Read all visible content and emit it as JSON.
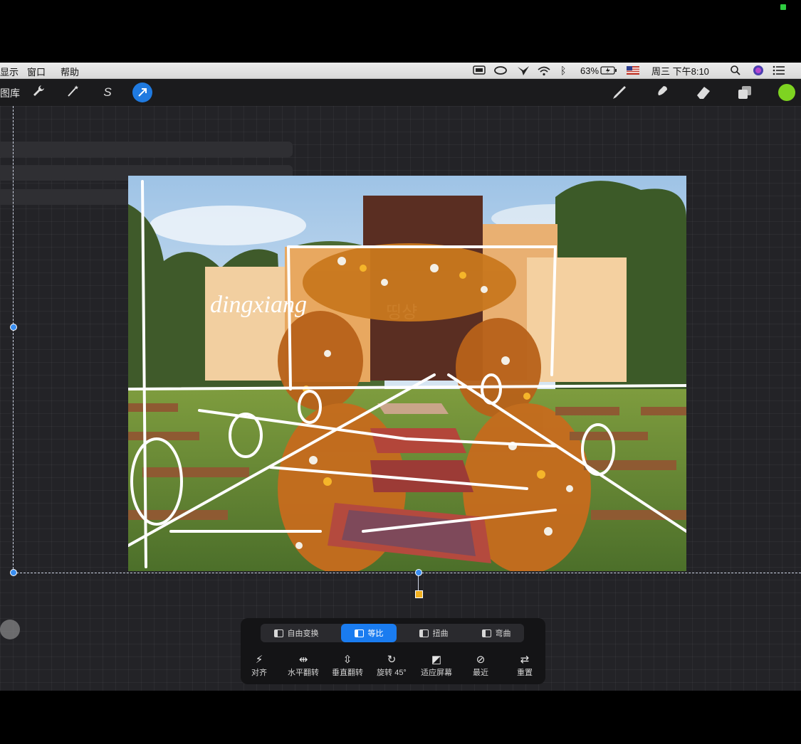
{
  "menubar": {
    "left_items": [
      "显示",
      "窗口",
      "帮助"
    ],
    "battery": "63%",
    "clock": "周三 下午8:10"
  },
  "toolbar": {
    "gallery_label": "图库",
    "left_tools": [
      {
        "icon": "wrench-icon",
        "glyph": "🔧"
      },
      {
        "icon": "magic-wand-icon",
        "glyph": "⁄"
      },
      {
        "icon": "selection-icon",
        "glyph": "S"
      },
      {
        "icon": "transform-arrow-icon",
        "glyph": "➚"
      }
    ],
    "right_tools": [
      {
        "icon": "brush-icon"
      },
      {
        "icon": "smudge-icon"
      },
      {
        "icon": "eraser-icon"
      },
      {
        "icon": "layers-icon"
      }
    ],
    "current_color": "#7ed321"
  },
  "artwork": {
    "sign_text": "dingxiang",
    "door_text": "띵샹"
  },
  "transform_panel": {
    "modes": [
      {
        "label": "自由变换",
        "active": false
      },
      {
        "label": "等比",
        "active": true
      },
      {
        "label": "扭曲",
        "active": false
      },
      {
        "label": "弯曲",
        "active": false
      }
    ],
    "actions": [
      {
        "label": "对齐",
        "icon": "snap-icon",
        "glyph": "⚡"
      },
      {
        "label": "水平翻转",
        "icon": "flip-horizontal-icon",
        "glyph": "⇹"
      },
      {
        "label": "垂直翻转",
        "icon": "flip-vertical-icon",
        "glyph": "⇳"
      },
      {
        "label": "旋转 45°",
        "icon": "rotate-icon",
        "glyph": "↻"
      },
      {
        "label": "适应屏幕",
        "icon": "fit-screen-icon",
        "glyph": "◩"
      },
      {
        "label": "最近",
        "icon": "recent-icon",
        "glyph": "⊘"
      },
      {
        "label": "重置",
        "icon": "reset-icon",
        "glyph": "⇄"
      }
    ]
  },
  "colors": {
    "accent": "#1a7cf0",
    "handle": "#3a8ef0",
    "rotate_handle": "#f2b01e"
  }
}
